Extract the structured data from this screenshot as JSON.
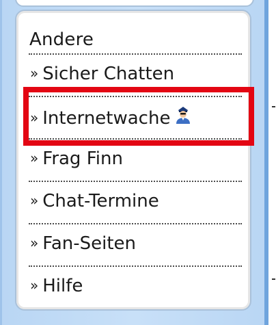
{
  "menu": {
    "heading": "Andere",
    "items": [
      {
        "label": "Sicher Chatten",
        "icon": "chevron-right-icon"
      },
      {
        "label": "Internetwache",
        "icon": "chevron-right-icon",
        "trailing_icon": "police-officer-icon",
        "highlighted": true
      },
      {
        "label": "Frag Finn",
        "icon": "chevron-right-icon"
      },
      {
        "label": "Chat-Termine",
        "icon": "chevron-right-icon"
      },
      {
        "label": "Fan-Seiten",
        "icon": "chevron-right-icon"
      },
      {
        "label": "Hilfe",
        "icon": "chevron-right-icon"
      }
    ],
    "chevron_glyph": "»"
  },
  "colors": {
    "highlight": "#e30613",
    "panel_border": "#a9c1da",
    "background_blue": "#c8e0f8"
  }
}
